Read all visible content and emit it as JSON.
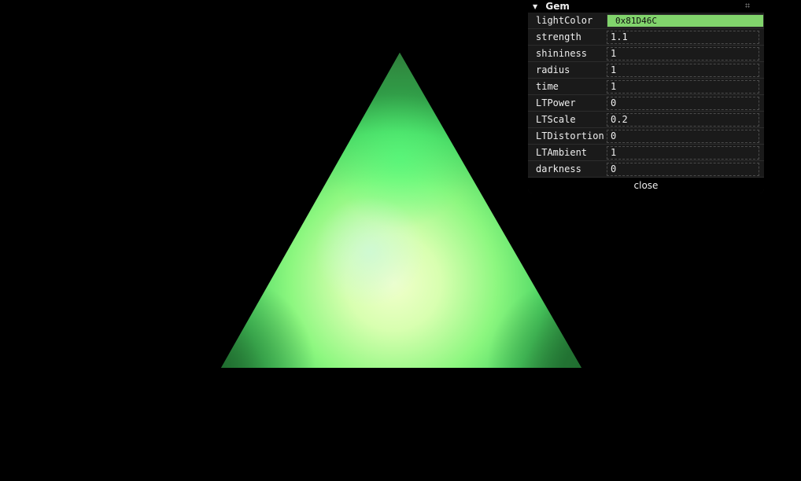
{
  "scene": {
    "object": "triangle-gem",
    "light_color_hex": "#81D46C"
  },
  "gui": {
    "folder_title": "Gem",
    "close_label": "close",
    "controls": [
      {
        "label": "lightColor",
        "value": "0x81D46C",
        "type": "color"
      },
      {
        "label": "strength",
        "value": "1.1",
        "type": "number"
      },
      {
        "label": "shininess",
        "value": "1",
        "type": "number"
      },
      {
        "label": "radius",
        "value": "1",
        "type": "number"
      },
      {
        "label": "time",
        "value": "1",
        "type": "number"
      },
      {
        "label": "LTPower",
        "value": "0",
        "type": "number"
      },
      {
        "label": "LTScale",
        "value": "0.2",
        "type": "number"
      },
      {
        "label": "LTDistortion",
        "value": "0",
        "type": "number"
      },
      {
        "label": "LTAmbient",
        "value": "1",
        "type": "number"
      },
      {
        "label": "darkness",
        "value": "0",
        "type": "number"
      }
    ]
  }
}
